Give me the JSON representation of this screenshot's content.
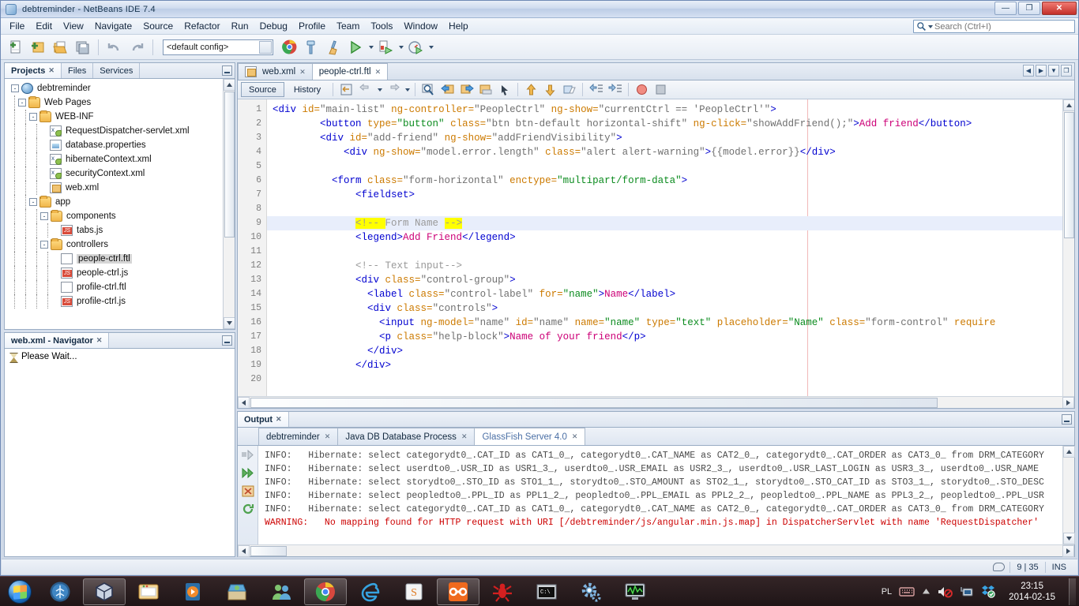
{
  "window": {
    "title": "debtreminder - NetBeans IDE 7.4",
    "minimize_label": "—",
    "maximize_label": "❐",
    "close_label": "✕"
  },
  "menubar": {
    "items": [
      "File",
      "Edit",
      "View",
      "Navigate",
      "Source",
      "Refactor",
      "Run",
      "Debug",
      "Profile",
      "Team",
      "Tools",
      "Window",
      "Help"
    ]
  },
  "search": {
    "placeholder": "Search (Ctrl+I)",
    "value": ""
  },
  "toolbar": {
    "config_value": "<default config>",
    "buttons": [
      "new-file",
      "new-project",
      "open-project",
      "save-all",
      "undo",
      "redo",
      "run-browser",
      "build-project",
      "clean-and-build",
      "run-project",
      "debug-project",
      "profile-project"
    ]
  },
  "left": {
    "explorer_tabs": [
      {
        "label": "Projects",
        "closable": true,
        "active": true
      },
      {
        "label": "Files",
        "closable": false,
        "active": false
      },
      {
        "label": "Services",
        "closable": false,
        "active": false
      }
    ],
    "tree": [
      {
        "label": "debtreminder",
        "depth": 0,
        "icon": "globe",
        "toggle": "-",
        "selected": false
      },
      {
        "label": "Web Pages",
        "depth": 1,
        "icon": "folder-badge",
        "toggle": "-",
        "selected": false
      },
      {
        "label": "WEB-INF",
        "depth": 2,
        "icon": "folder",
        "toggle": "-",
        "selected": false
      },
      {
        "label": "RequestDispatcher-servlet.xml",
        "depth": 3,
        "icon": "xml",
        "toggle": "",
        "selected": false
      },
      {
        "label": "database.properties",
        "depth": 3,
        "icon": "prop",
        "toggle": "",
        "selected": false
      },
      {
        "label": "hibernateContext.xml",
        "depth": 3,
        "icon": "xml",
        "toggle": "",
        "selected": false
      },
      {
        "label": "securityContext.xml",
        "depth": 3,
        "icon": "xml",
        "toggle": "",
        "selected": false
      },
      {
        "label": "web.xml",
        "depth": 3,
        "icon": "webxml",
        "toggle": "",
        "selected": false
      },
      {
        "label": "app",
        "depth": 2,
        "icon": "folder",
        "toggle": "-",
        "selected": false
      },
      {
        "label": "components",
        "depth": 3,
        "icon": "folder",
        "toggle": "-",
        "selected": false
      },
      {
        "label": "tabs.js",
        "depth": 4,
        "icon": "js",
        "toggle": "",
        "selected": false
      },
      {
        "label": "controllers",
        "depth": 3,
        "icon": "folder",
        "toggle": "-",
        "selected": false
      },
      {
        "label": "people-ctrl.ftl",
        "depth": 4,
        "icon": "plain",
        "toggle": "",
        "selected": true
      },
      {
        "label": "people-ctrl.js",
        "depth": 4,
        "icon": "js",
        "toggle": "",
        "selected": false
      },
      {
        "label": "profile-ctrl.ftl",
        "depth": 4,
        "icon": "plain",
        "toggle": "",
        "selected": false
      },
      {
        "label": "profile-ctrl.js",
        "depth": 4,
        "icon": "js",
        "toggle": "",
        "selected": false
      }
    ],
    "navigator": {
      "tab_label": "web.xml - Navigator",
      "status": "Please Wait..."
    }
  },
  "editor": {
    "tabs": [
      {
        "label": "web.xml",
        "icon": "webxml",
        "active": false
      },
      {
        "label": "people-ctrl.ftl",
        "icon": "none",
        "active": true
      }
    ],
    "view_buttons": [
      "Source",
      "History"
    ],
    "active_view": "Source",
    "cursor_line": 9,
    "lines": [
      {
        "n": 1,
        "tokens": [
          {
            "t": "<div ",
            "c": "tag"
          },
          {
            "t": "id=",
            "c": "attr"
          },
          {
            "t": "\"main-list\"",
            "c": "val"
          },
          {
            "t": " ",
            "c": "plain"
          },
          {
            "t": "ng-controller=",
            "c": "attr"
          },
          {
            "t": "\"PeopleCtrl\"",
            "c": "val"
          },
          {
            "t": " ",
            "c": "plain"
          },
          {
            "t": "ng-show=",
            "c": "attr"
          },
          {
            "t": "\"currentCtrl == 'PeopleCtrl'\"",
            "c": "val"
          },
          {
            "t": ">",
            "c": "tag"
          }
        ]
      },
      {
        "n": 2,
        "indent": 4,
        "tokens": [
          {
            "t": "<button ",
            "c": "tag"
          },
          {
            "t": "type=",
            "c": "attr"
          },
          {
            "t": "\"button\"",
            "c": "str"
          },
          {
            "t": " ",
            "c": "plain"
          },
          {
            "t": "class=",
            "c": "attr"
          },
          {
            "t": "\"btn btn-default horizontal-shift\"",
            "c": "val"
          },
          {
            "t": " ",
            "c": "plain"
          },
          {
            "t": "ng-click=",
            "c": "attr"
          },
          {
            "t": "\"showAddFriend();\"",
            "c": "val"
          },
          {
            "t": ">",
            "c": "tag"
          },
          {
            "t": "Add friend",
            "c": "txt"
          },
          {
            "t": "</button>",
            "c": "tag"
          }
        ]
      },
      {
        "n": 3,
        "indent": 4,
        "tokens": [
          {
            "t": "<div ",
            "c": "tag"
          },
          {
            "t": "id=",
            "c": "attr"
          },
          {
            "t": "\"add-friend\"",
            "c": "val"
          },
          {
            "t": " ",
            "c": "plain"
          },
          {
            "t": "ng-show=",
            "c": "attr"
          },
          {
            "t": "\"addFriendVisibility\"",
            "c": "val"
          },
          {
            "t": ">",
            "c": "tag"
          }
        ]
      },
      {
        "n": 4,
        "indent": 6,
        "tokens": [
          {
            "t": "<div ",
            "c": "tag"
          },
          {
            "t": "ng-show=",
            "c": "attr"
          },
          {
            "t": "\"model.error.length\"",
            "c": "val"
          },
          {
            "t": " ",
            "c": "plain"
          },
          {
            "t": "class=",
            "c": "attr"
          },
          {
            "t": "\"alert alert-warning\"",
            "c": "val"
          },
          {
            "t": ">",
            "c": "tag"
          },
          {
            "t": "{{model.error}}",
            "c": "val"
          },
          {
            "t": "</div>",
            "c": "tag"
          }
        ]
      },
      {
        "n": 5,
        "indent": 0,
        "tokens": []
      },
      {
        "n": 6,
        "indent": 5,
        "tokens": [
          {
            "t": "<form ",
            "c": "tag"
          },
          {
            "t": "class=",
            "c": "attr"
          },
          {
            "t": "\"form-horizontal\"",
            "c": "val"
          },
          {
            "t": " ",
            "c": "plain"
          },
          {
            "t": "enctype=",
            "c": "attr"
          },
          {
            "t": "\"multipart/form-data\"",
            "c": "str"
          },
          {
            "t": ">",
            "c": "tag"
          }
        ]
      },
      {
        "n": 7,
        "indent": 7,
        "tokens": [
          {
            "t": "<fieldset>",
            "c": "tag"
          }
        ]
      },
      {
        "n": 8,
        "indent": 0,
        "tokens": []
      },
      {
        "n": 9,
        "indent": 7,
        "tokens": [
          {
            "t": "<!-- ",
            "c": "com-hl"
          },
          {
            "t": "Form Name ",
            "c": "com"
          },
          {
            "t": "-->",
            "c": "com-hl"
          }
        ]
      },
      {
        "n": 10,
        "indent": 7,
        "tokens": [
          {
            "t": "<legend>",
            "c": "tag"
          },
          {
            "t": "Add Friend",
            "c": "txt"
          },
          {
            "t": "</legend>",
            "c": "tag"
          }
        ]
      },
      {
        "n": 11,
        "indent": 0,
        "tokens": []
      },
      {
        "n": 12,
        "indent": 7,
        "tokens": [
          {
            "t": "<!-- Text input-->",
            "c": "com"
          }
        ]
      },
      {
        "n": 13,
        "indent": 7,
        "tokens": [
          {
            "t": "<div ",
            "c": "tag"
          },
          {
            "t": "class=",
            "c": "attr"
          },
          {
            "t": "\"control-group\"",
            "c": "val"
          },
          {
            "t": ">",
            "c": "tag"
          }
        ]
      },
      {
        "n": 14,
        "indent": 8,
        "tokens": [
          {
            "t": "<label ",
            "c": "tag"
          },
          {
            "t": "class=",
            "c": "attr"
          },
          {
            "t": "\"control-label\"",
            "c": "val"
          },
          {
            "t": " ",
            "c": "plain"
          },
          {
            "t": "for=",
            "c": "attr"
          },
          {
            "t": "\"name\"",
            "c": "str"
          },
          {
            "t": ">",
            "c": "tag"
          },
          {
            "t": "Name",
            "c": "txt"
          },
          {
            "t": "</label>",
            "c": "tag"
          }
        ]
      },
      {
        "n": 15,
        "indent": 8,
        "tokens": [
          {
            "t": "<div ",
            "c": "tag"
          },
          {
            "t": "class=",
            "c": "attr"
          },
          {
            "t": "\"controls\"",
            "c": "val"
          },
          {
            "t": ">",
            "c": "tag"
          }
        ]
      },
      {
        "n": 16,
        "indent": 9,
        "tokens": [
          {
            "t": "<input ",
            "c": "tag"
          },
          {
            "t": "ng-model=",
            "c": "attr"
          },
          {
            "t": "\"name\"",
            "c": "val"
          },
          {
            "t": " ",
            "c": "plain"
          },
          {
            "t": "id=",
            "c": "attr"
          },
          {
            "t": "\"name\"",
            "c": "val"
          },
          {
            "t": " ",
            "c": "plain"
          },
          {
            "t": "name=",
            "c": "attr"
          },
          {
            "t": "\"name\"",
            "c": "str"
          },
          {
            "t": " ",
            "c": "plain"
          },
          {
            "t": "type=",
            "c": "attr"
          },
          {
            "t": "\"text\"",
            "c": "str"
          },
          {
            "t": " ",
            "c": "plain"
          },
          {
            "t": "placeholder=",
            "c": "attr"
          },
          {
            "t": "\"Name\"",
            "c": "str"
          },
          {
            "t": " ",
            "c": "plain"
          },
          {
            "t": "class=",
            "c": "attr"
          },
          {
            "t": "\"form-control\"",
            "c": "val"
          },
          {
            "t": " ",
            "c": "plain"
          },
          {
            "t": "require",
            "c": "attr"
          }
        ]
      },
      {
        "n": 17,
        "indent": 9,
        "tokens": [
          {
            "t": "<p ",
            "c": "tag"
          },
          {
            "t": "class=",
            "c": "attr"
          },
          {
            "t": "\"help-block\"",
            "c": "val"
          },
          {
            "t": ">",
            "c": "tag"
          },
          {
            "t": "Name of your friend",
            "c": "txt"
          },
          {
            "t": "</p>",
            "c": "tag"
          }
        ]
      },
      {
        "n": 18,
        "indent": 8,
        "tokens": [
          {
            "t": "</div>",
            "c": "tag"
          }
        ]
      },
      {
        "n": 19,
        "indent": 7,
        "tokens": [
          {
            "t": "</div>",
            "c": "tag"
          }
        ]
      },
      {
        "n": 20,
        "indent": 0,
        "tokens": []
      }
    ]
  },
  "output": {
    "window_tab": "Output",
    "tabs": [
      {
        "label": "debtreminder",
        "active": false
      },
      {
        "label": "Java DB Database Process",
        "active": false
      },
      {
        "label": "GlassFish Server 4.0",
        "active": true
      }
    ],
    "lines": [
      {
        "level": "INFO:",
        "text": "Hibernate: select categorydt0_.CAT_ID as CAT1_0_, categorydt0_.CAT_NAME as CAT2_0_, categorydt0_.CAT_ORDER as CAT3_0_ from DRM_CATEGORY",
        "type": "info"
      },
      {
        "level": "INFO:",
        "text": "Hibernate: select userdto0_.USR_ID as USR1_3_, userdto0_.USR_EMAIL as USR2_3_, userdto0_.USR_LAST_LOGIN as USR3_3_, userdto0_.USR_NAME",
        "type": "info"
      },
      {
        "level": "INFO:",
        "text": "Hibernate: select storydto0_.STO_ID as STO1_1_, storydto0_.STO_AMOUNT as STO2_1_, storydto0_.STO_CAT_ID as STO3_1_, storydto0_.STO_DESC",
        "type": "info"
      },
      {
        "level": "INFO:",
        "text": "Hibernate: select peopledto0_.PPL_ID as PPL1_2_, peopledto0_.PPL_EMAIL as PPL2_2_, peopledto0_.PPL_NAME as PPL3_2_, peopledto0_.PPL_USR",
        "type": "info"
      },
      {
        "level": "INFO:",
        "text": "Hibernate: select categorydt0_.CAT_ID as CAT1_0_, categorydt0_.CAT_NAME as CAT2_0_, categorydt0_.CAT_ORDER as CAT3_0_ from DRM_CATEGORY",
        "type": "info"
      },
      {
        "level": "WARNING:",
        "text": "No mapping found for HTTP request with URI [/debtreminder/js/angular.min.js.map] in DispatcherServlet with name 'RequestDispatcher'",
        "type": "warn"
      }
    ]
  },
  "statusbar": {
    "position": "9 | 35",
    "insert_mode": "INS"
  },
  "taskbar": {
    "items": [
      {
        "name": "start-orb",
        "active": false
      },
      {
        "name": "netbeans",
        "active": false
      },
      {
        "name": "virtualbox",
        "active": true
      },
      {
        "name": "file-explorer",
        "active": false
      },
      {
        "name": "media-player",
        "active": false
      },
      {
        "name": "app-store",
        "active": false
      },
      {
        "name": "messenger",
        "active": false
      },
      {
        "name": "chrome",
        "active": true
      },
      {
        "name": "internet-explorer",
        "active": false
      },
      {
        "name": "sublime-text",
        "active": false
      },
      {
        "name": "xampp",
        "active": true
      },
      {
        "name": "ant",
        "active": false
      },
      {
        "name": "command-prompt",
        "active": false
      },
      {
        "name": "settings",
        "active": false
      },
      {
        "name": "task-manager",
        "active": false
      }
    ],
    "tray": {
      "language": "PL",
      "icons": [
        "keyboard",
        "show-hidden",
        "volume-muted",
        "network",
        "dropbox"
      ],
      "time": "23:15",
      "date": "2014-02-15"
    }
  },
  "colors": {
    "accent": "#4a6fa5",
    "warning": "#cc0000",
    "highlight": "#ffff00",
    "selection": "#e8eefb"
  }
}
